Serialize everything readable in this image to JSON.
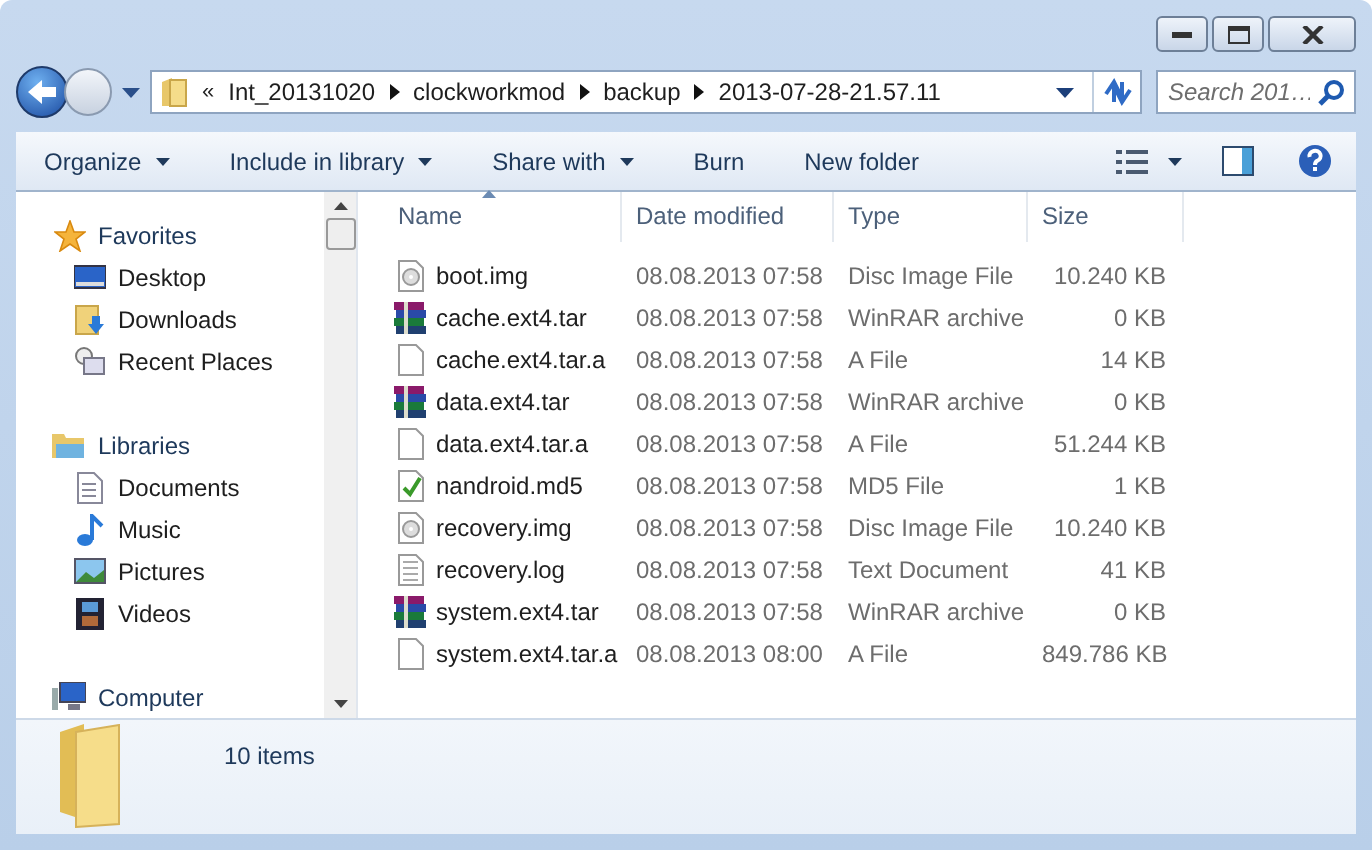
{
  "address": {
    "overflow": "«",
    "segments": [
      "Int_20131020",
      "clockworkmod",
      "backup",
      "2013-07-28-21.57.11"
    ]
  },
  "search": {
    "placeholder": "Search 201…"
  },
  "toolbar": [
    {
      "label": "Organize",
      "menu": true
    },
    {
      "label": "Include in library",
      "menu": true
    },
    {
      "label": "Share with",
      "menu": true
    },
    {
      "label": "Burn",
      "menu": false
    },
    {
      "label": "New folder",
      "menu": false
    }
  ],
  "sidebar": {
    "groups": [
      {
        "label": "Favorites",
        "kind": "star",
        "children": [
          {
            "label": "Desktop",
            "kind": "desktop"
          },
          {
            "label": "Downloads",
            "kind": "downloads"
          },
          {
            "label": "Recent Places",
            "kind": "recent"
          }
        ]
      },
      {
        "label": "Libraries",
        "kind": "library",
        "children": [
          {
            "label": "Documents",
            "kind": "documents"
          },
          {
            "label": "Music",
            "kind": "music"
          },
          {
            "label": "Pictures",
            "kind": "pictures"
          },
          {
            "label": "Videos",
            "kind": "videos"
          }
        ]
      },
      {
        "label": "Computer",
        "kind": "computer"
      }
    ]
  },
  "table": {
    "columns": [
      {
        "label": "Name",
        "sorted": true
      },
      {
        "label": "Date modified",
        "sorted": false
      },
      {
        "label": "Type",
        "sorted": false
      },
      {
        "label": "Size",
        "sorted": false
      }
    ],
    "rows": [
      {
        "name": "boot.img",
        "kind": "disc",
        "date": "08.08.2013 07:58",
        "type": "Disc Image File",
        "size": "10.240 KB"
      },
      {
        "name": "cache.ext4.tar",
        "kind": "rar",
        "date": "08.08.2013 07:58",
        "type": "WinRAR archive",
        "size": "0 KB"
      },
      {
        "name": "cache.ext4.tar.a",
        "kind": "blank",
        "date": "08.08.2013 07:58",
        "type": "A File",
        "size": "14 KB"
      },
      {
        "name": "data.ext4.tar",
        "kind": "rar",
        "date": "08.08.2013 07:58",
        "type": "WinRAR archive",
        "size": "0 KB"
      },
      {
        "name": "data.ext4.tar.a",
        "kind": "blank",
        "date": "08.08.2013 07:58",
        "type": "A File",
        "size": "51.244 KB"
      },
      {
        "name": "nandroid.md5",
        "kind": "md5",
        "date": "08.08.2013 07:58",
        "type": "MD5 File",
        "size": "1 KB"
      },
      {
        "name": "recovery.img",
        "kind": "disc",
        "date": "08.08.2013 07:58",
        "type": "Disc Image File",
        "size": "10.240 KB"
      },
      {
        "name": "recovery.log",
        "kind": "text",
        "date": "08.08.2013 07:58",
        "type": "Text Document",
        "size": "41 KB"
      },
      {
        "name": "system.ext4.tar",
        "kind": "rar",
        "date": "08.08.2013 07:58",
        "type": "WinRAR archive",
        "size": "0 KB"
      },
      {
        "name": "system.ext4.tar.a",
        "kind": "blank",
        "date": "08.08.2013 08:00",
        "type": "A File",
        "size": "849.786 KB"
      }
    ]
  },
  "status_bar": {
    "count": "10 items"
  }
}
